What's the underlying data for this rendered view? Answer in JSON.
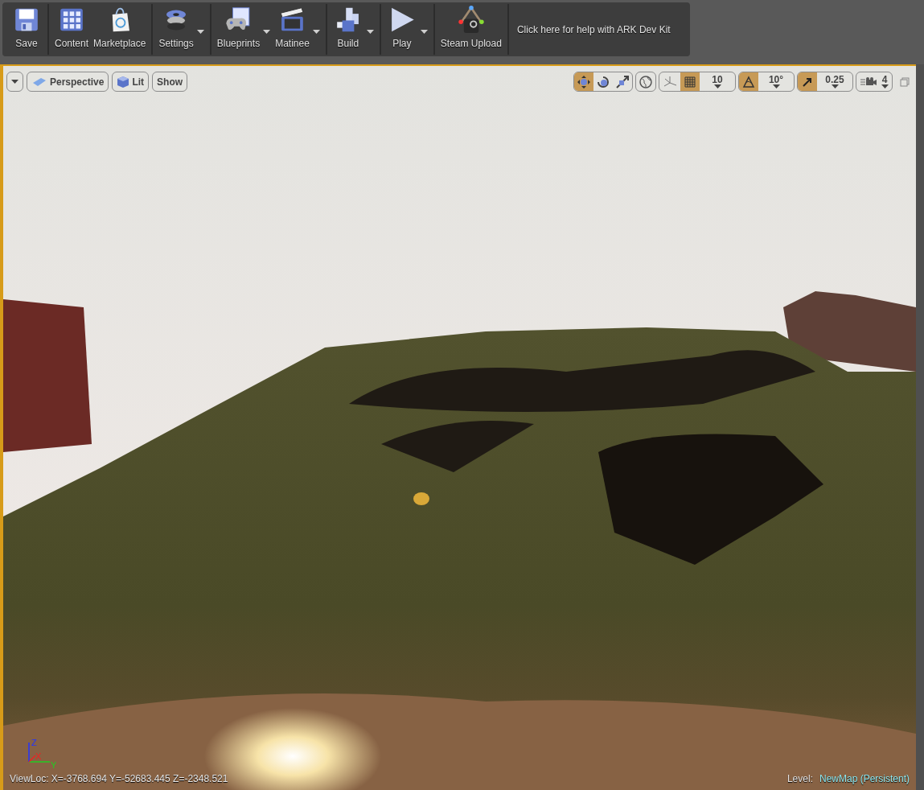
{
  "toolbar": {
    "groups": [
      [
        {
          "label": "Save",
          "dropdown": false
        }
      ],
      [
        {
          "label": "Content",
          "dropdown": false
        },
        {
          "label": "Marketplace",
          "dropdown": false
        }
      ],
      [
        {
          "label": "Settings",
          "dropdown": true
        }
      ],
      [
        {
          "label": "Blueprints",
          "dropdown": true
        },
        {
          "label": "Matinee",
          "dropdown": true
        }
      ],
      [
        {
          "label": "Build",
          "dropdown": true
        }
      ],
      [
        {
          "label": "Play",
          "dropdown": true
        }
      ],
      [
        {
          "label": "Steam Upload",
          "dropdown": false
        }
      ]
    ],
    "help_text": "Click here for help with ARK Dev Kit"
  },
  "viewport": {
    "left_controls": [
      {
        "kind": "menu"
      },
      {
        "kind": "perspective",
        "label": "Perspective"
      },
      {
        "kind": "lit",
        "label": "Lit"
      },
      {
        "kind": "show",
        "label": "Show"
      }
    ],
    "transform_tools": [
      {
        "selected": true
      },
      {
        "selected": false
      },
      {
        "selected": false
      }
    ],
    "snaps": [
      {
        "kind": "grid",
        "on": true,
        "value": "10"
      },
      {
        "kind": "rotation",
        "on": true,
        "value": "10°"
      },
      {
        "kind": "scale",
        "on": true,
        "value": "0.25"
      }
    ],
    "camera_speed": "4",
    "axes": {
      "z": "Z",
      "x": "X",
      "y": "Y"
    },
    "view_location": "ViewLoc: X=-3768.694 Y=-52683.445 Z=-2348.521",
    "level_label": "Level:",
    "level_name": "NewMap (Persistent)"
  }
}
